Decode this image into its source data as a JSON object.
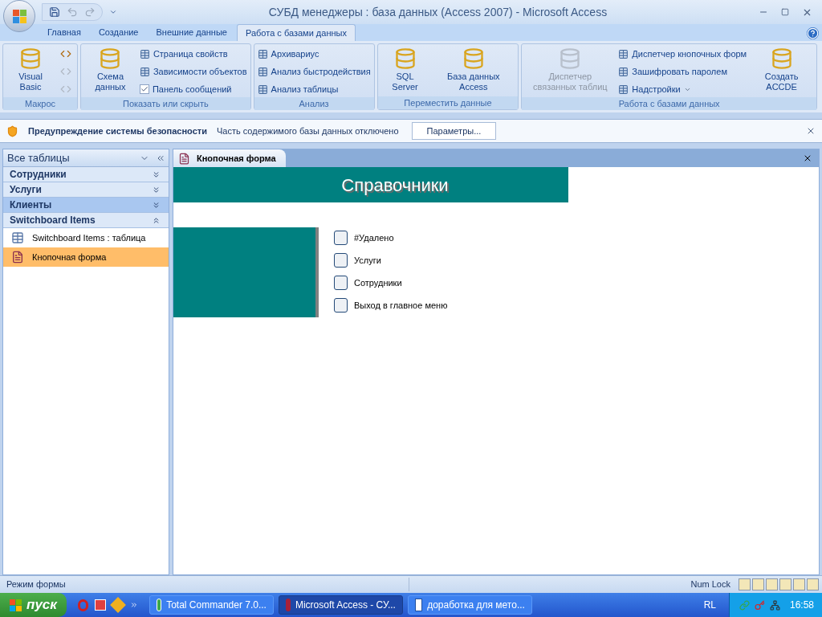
{
  "window": {
    "title": "СУБД менеджеры : база данных (Access 2007)  -  Microsoft Access"
  },
  "ribbon_tabs": [
    {
      "label": "Главная",
      "selected": false
    },
    {
      "label": "Создание",
      "selected": false
    },
    {
      "label": "Внешние данные",
      "selected": false
    },
    {
      "label": "Работа с базами данных",
      "selected": true
    }
  ],
  "ribbon_groups": [
    {
      "label": "Макрос",
      "items": [
        {
          "kind": "large",
          "label": "Visual Basic",
          "disabled": false
        },
        {
          "kind": "icon",
          "disabled": false
        },
        {
          "kind": "icon",
          "disabled": true
        },
        {
          "kind": "icon",
          "disabled": true
        }
      ]
    },
    {
      "label": "Показать или скрыть",
      "items": [
        {
          "kind": "large",
          "label": "Схема данных",
          "disabled": false
        },
        {
          "kind": "small",
          "label": "Страница свойств",
          "disabled": false
        },
        {
          "kind": "small",
          "label": "Зависимости объектов",
          "disabled": false
        },
        {
          "kind": "check",
          "label": "Панель сообщений",
          "checked": true
        }
      ]
    },
    {
      "label": "Анализ",
      "items": [
        {
          "kind": "small",
          "label": "Архивариус",
          "disabled": false
        },
        {
          "kind": "small",
          "label": "Анализ быстродействия",
          "disabled": false
        },
        {
          "kind": "small",
          "label": "Анализ таблицы",
          "disabled": false
        }
      ]
    },
    {
      "label": "Переместить данные",
      "items": [
        {
          "kind": "large",
          "label": "SQL Server",
          "disabled": false
        },
        {
          "kind": "large",
          "label": "База данных Access",
          "disabled": false
        }
      ]
    },
    {
      "label": "Работа с базами данных",
      "items": [
        {
          "kind": "large",
          "label": "Диспетчер связанных таблиц",
          "disabled": true
        },
        {
          "kind": "small",
          "label": "Диспетчер кнопочных форм",
          "disabled": false
        },
        {
          "kind": "small",
          "label": "Зашифровать паролем",
          "disabled": false
        },
        {
          "kind": "menu",
          "label": "Надстройки",
          "disabled": false
        },
        {
          "kind": "large",
          "label": "Создать ACCDE",
          "disabled": false
        }
      ]
    }
  ],
  "security_bar": {
    "title": "Предупреждение системы безопасности",
    "message": "Часть содержимого базы данных отключено",
    "button": "Параметры..."
  },
  "nav_pane": {
    "header": "Все таблицы",
    "groups": [
      {
        "label": "Сотрудники",
        "expanded": false,
        "selected": false
      },
      {
        "label": "Услуги",
        "expanded": false,
        "selected": false
      },
      {
        "label": "Клиенты",
        "expanded": false,
        "selected": true
      },
      {
        "label": "Switchboard Items",
        "expanded": true,
        "selected": false,
        "children": [
          {
            "label": "Switchboard Items : таблица",
            "kind": "table",
            "selected": false
          },
          {
            "label": "Кнопочная форма",
            "kind": "form",
            "selected": true
          }
        ]
      }
    ]
  },
  "document_tab": {
    "label": "Кнопочная форма"
  },
  "form": {
    "title": "Справочники",
    "options": [
      {
        "label": "#Удалено"
      },
      {
        "label": "Услуги"
      },
      {
        "label": "Сотрудники"
      },
      {
        "label": "Выход в главное меню"
      }
    ]
  },
  "status_bar": {
    "mode": "Режим формы",
    "indicator": "Num Lock"
  },
  "taskbar": {
    "start": "пуск",
    "tasks": [
      {
        "label": "Total Commander 7.0...",
        "kind": "commander",
        "selected": false
      },
      {
        "label": "Microsoft Access - СУ...",
        "kind": "access",
        "selected": true
      },
      {
        "label": "доработка для мето...",
        "kind": "word",
        "selected": false
      }
    ],
    "language": "RL",
    "clock": "16:58"
  }
}
